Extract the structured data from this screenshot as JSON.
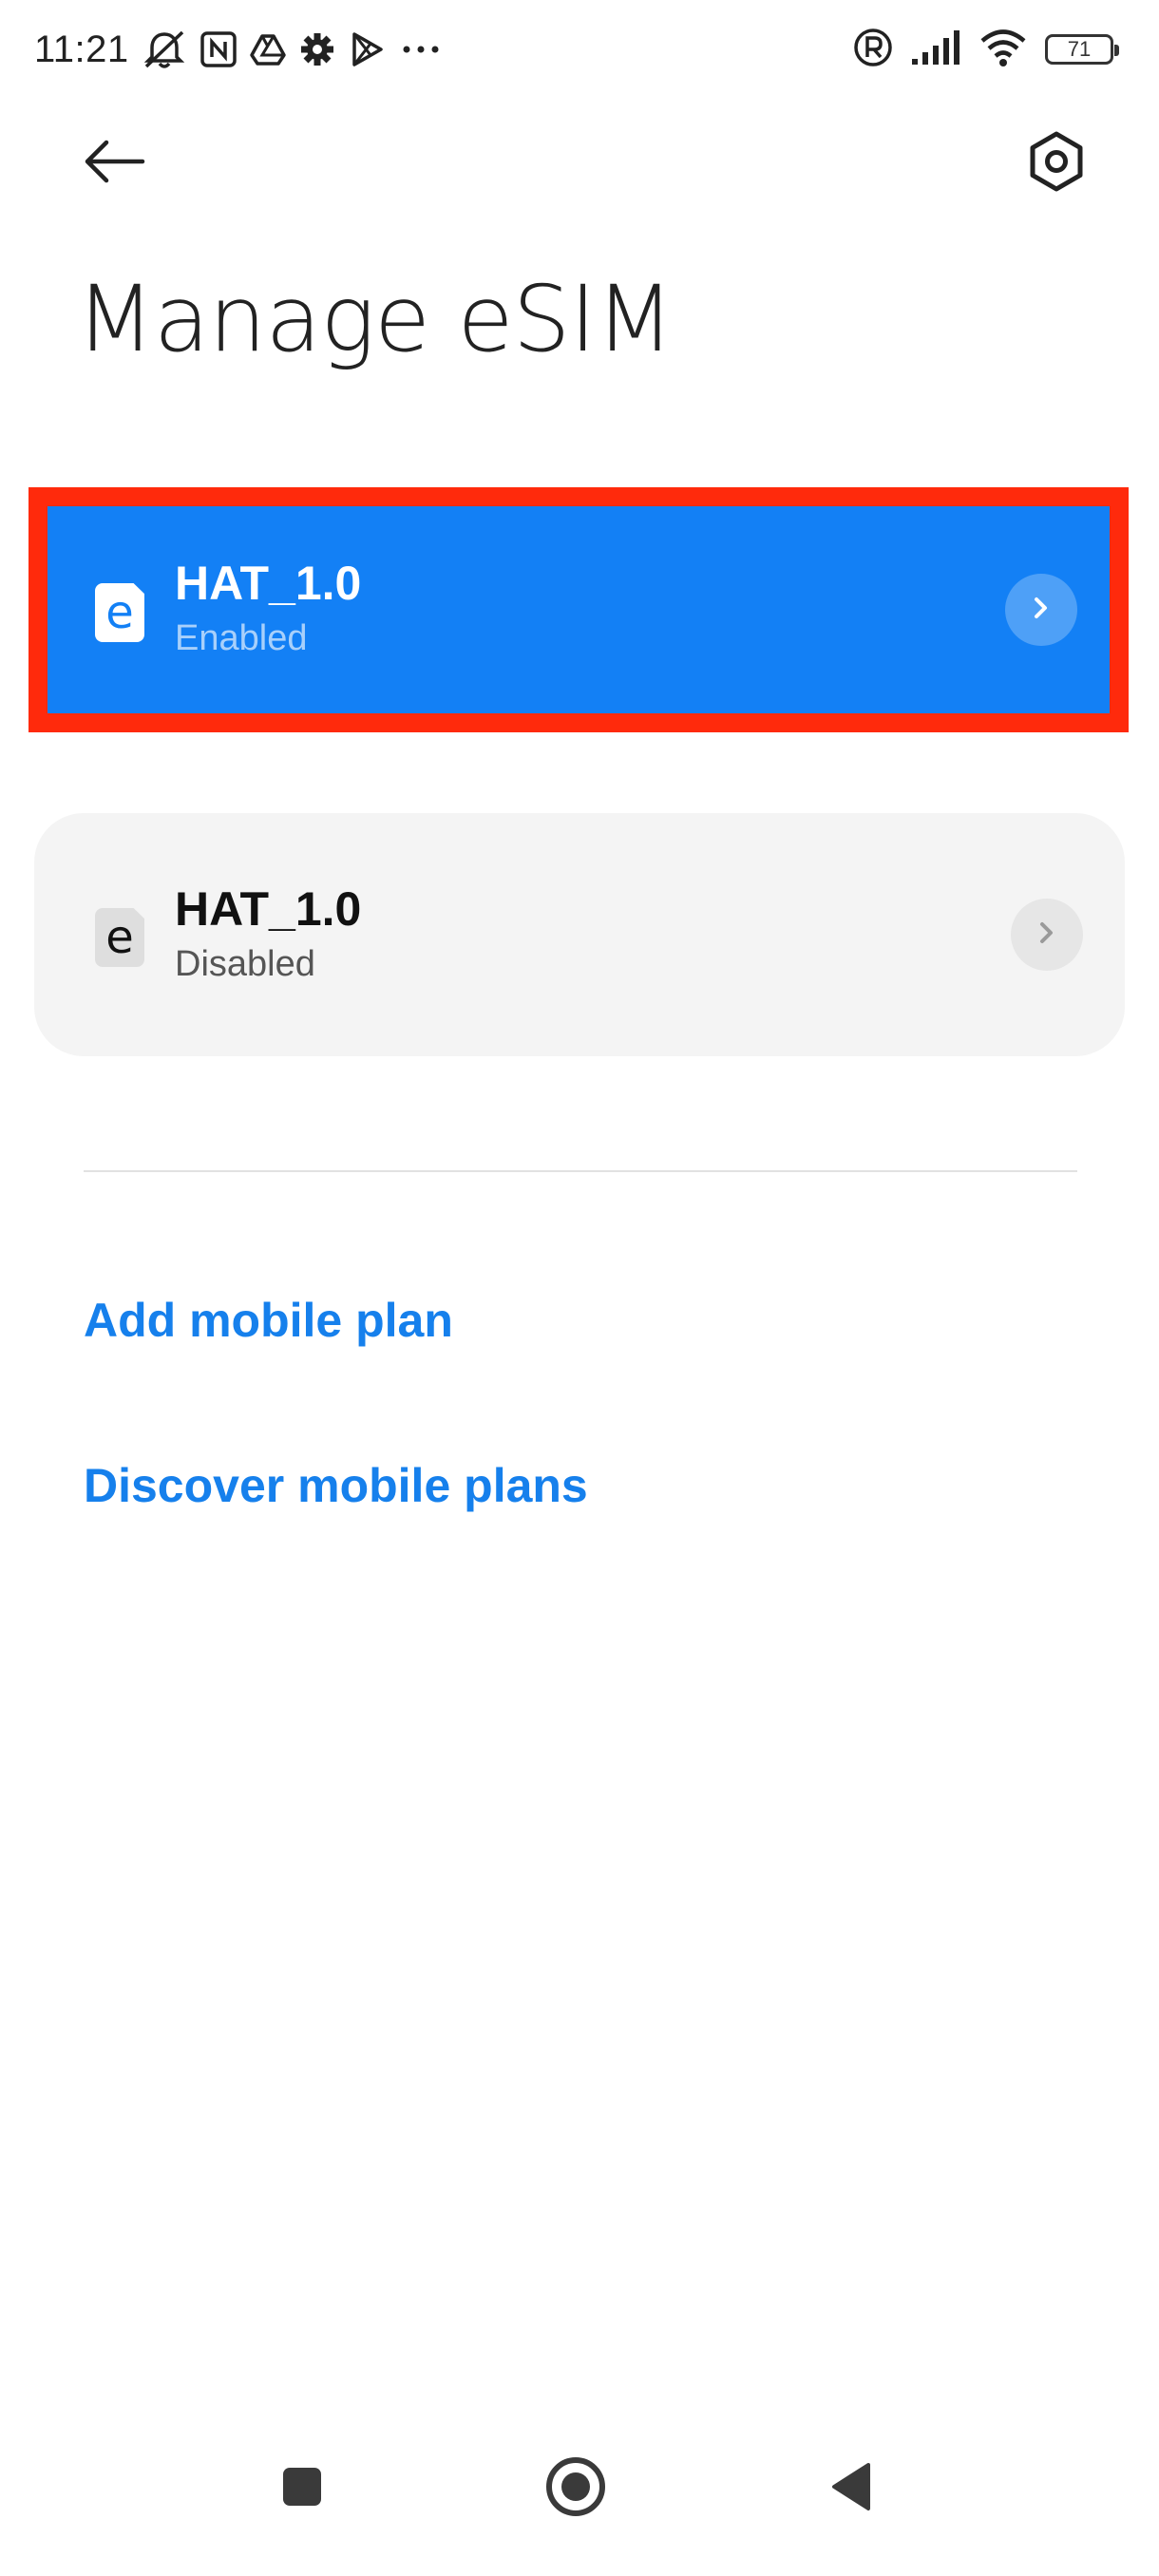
{
  "status_bar": {
    "time": "11:21",
    "battery_level": "71",
    "left_icons": [
      "notifications-muted-icon",
      "nfc-icon",
      "drive-icon",
      "settings-gear-icon",
      "play-store-icon",
      "more-dots-icon"
    ],
    "right_icons": [
      "roaming-r-icon",
      "cellular-signal-icon",
      "wifi-icon",
      "battery-icon"
    ]
  },
  "header": {
    "back_icon": "back-arrow-icon",
    "settings_icon": "settings-hex-icon",
    "title": "Manage eSIM"
  },
  "esims": [
    {
      "icon_letter": "e",
      "name": "HAT_1.0",
      "status": "Enabled",
      "state": "enabled",
      "accent_color": "#1380f5"
    },
    {
      "icon_letter": "e",
      "name": "HAT_1.0",
      "status": "Disabled",
      "state": "disabled",
      "accent_color": "#f4f4f4"
    }
  ],
  "actions": {
    "add_plan": "Add mobile plan",
    "discover_plans": "Discover mobile plans"
  },
  "colors": {
    "link": "#1680ec",
    "highlight_border": "#ff2a0c"
  },
  "nav_bar": {
    "items": [
      "recents-square-icon",
      "home-circle-icon",
      "back-triangle-icon"
    ]
  }
}
